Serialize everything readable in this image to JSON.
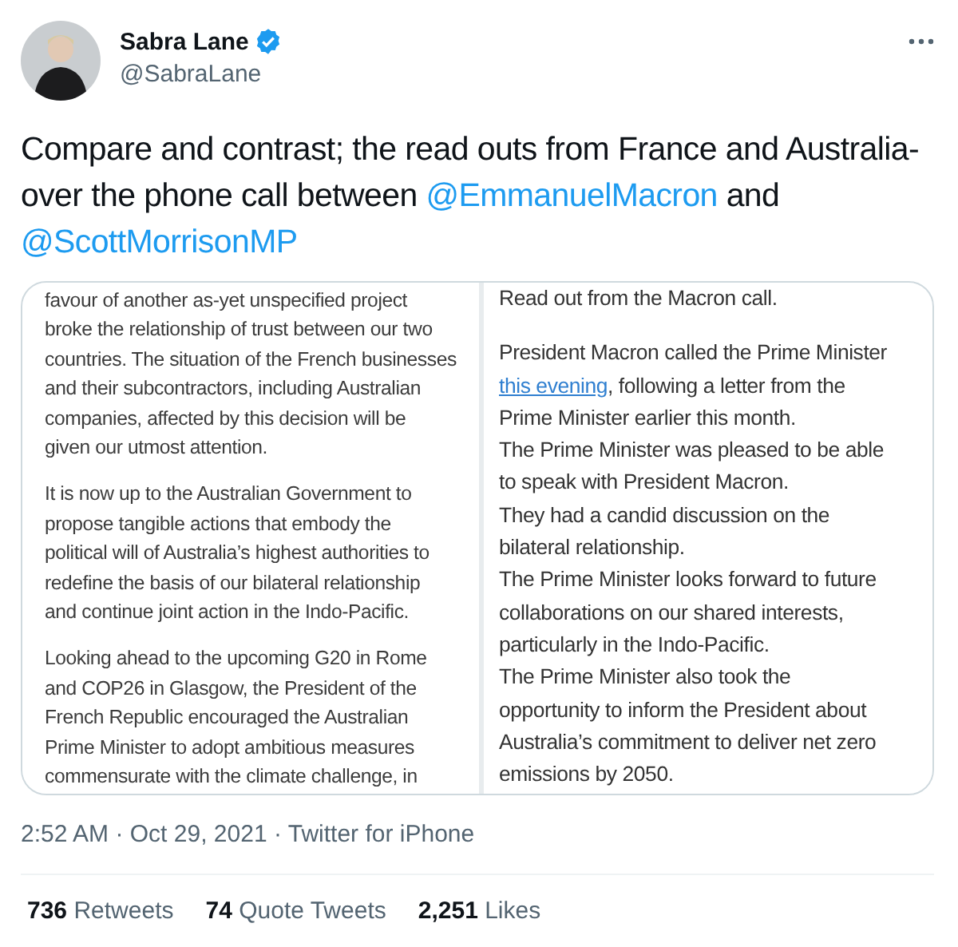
{
  "author": {
    "name": "Sabra Lane",
    "handle": "@SabraLane",
    "verified": true
  },
  "text": {
    "body": "Compare and contrast; the read outs from France and Australia- over the phone call between",
    "mentions": [
      "@EmmanuelMacron",
      "@ScottMorrisonMP"
    ],
    "joiner": "and"
  },
  "media": {
    "left": [
      {
        "lines": [
          "favour of another as-yet unspecified project",
          "broke the relationship of trust between our two",
          "countries. The situation of the French businesses",
          "and their subcontractors, including Australian",
          "companies, affected by this decision will be",
          "given our utmost attention."
        ]
      },
      {
        "lines": [
          "It is now up to the Australian Government to",
          "propose tangible actions that embody the",
          "political will of Australia’s highest authorities to",
          "redefine the basis of our bilateral relationship",
          "and continue joint action in the Indo-Pacific."
        ]
      },
      {
        "lines": [
          "Looking ahead to the upcoming G20 in Rome",
          "and COP26 in Glasgow, the President of the",
          "French Republic encouraged the Australian",
          "Prime Minister to adopt ambitious measures",
          "commensurate with the climate challenge, in"
        ]
      }
    ],
    "right": [
      {
        "lines": [
          {
            "text": "Read out from the Macron call."
          }
        ]
      },
      {
        "lines": [
          {
            "text": "President Macron called the Prime Minister"
          },
          {
            "link": "this evening",
            "text": ", following a letter from the"
          },
          {
            "text": "Prime Minister earlier this month."
          },
          {
            "text": "The Prime Minister was pleased to be able"
          },
          {
            "text": "to speak with President Macron."
          },
          {
            "text": "They had a candid discussion on the"
          },
          {
            "text": "bilateral relationship."
          },
          {
            "text": "The Prime Minister looks forward to future"
          },
          {
            "text": "collaborations on our shared interests,"
          },
          {
            "text": "particularly in the Indo-Pacific."
          },
          {
            "text": "The Prime Minister also took the"
          },
          {
            "text": "opportunity to inform the President about"
          },
          {
            "text": "Australia’s commitment to deliver net zero"
          },
          {
            "text": "emissions by 2050."
          }
        ]
      }
    ]
  },
  "meta": {
    "time": "2:52 AM",
    "date": "Oct 29, 2021",
    "source": "Twitter for iPhone",
    "separator": "·"
  },
  "stats": [
    {
      "count": "736",
      "label": "Retweets"
    },
    {
      "count": "74",
      "label": "Quote Tweets"
    },
    {
      "count": "2,251",
      "label": "Likes"
    }
  ]
}
